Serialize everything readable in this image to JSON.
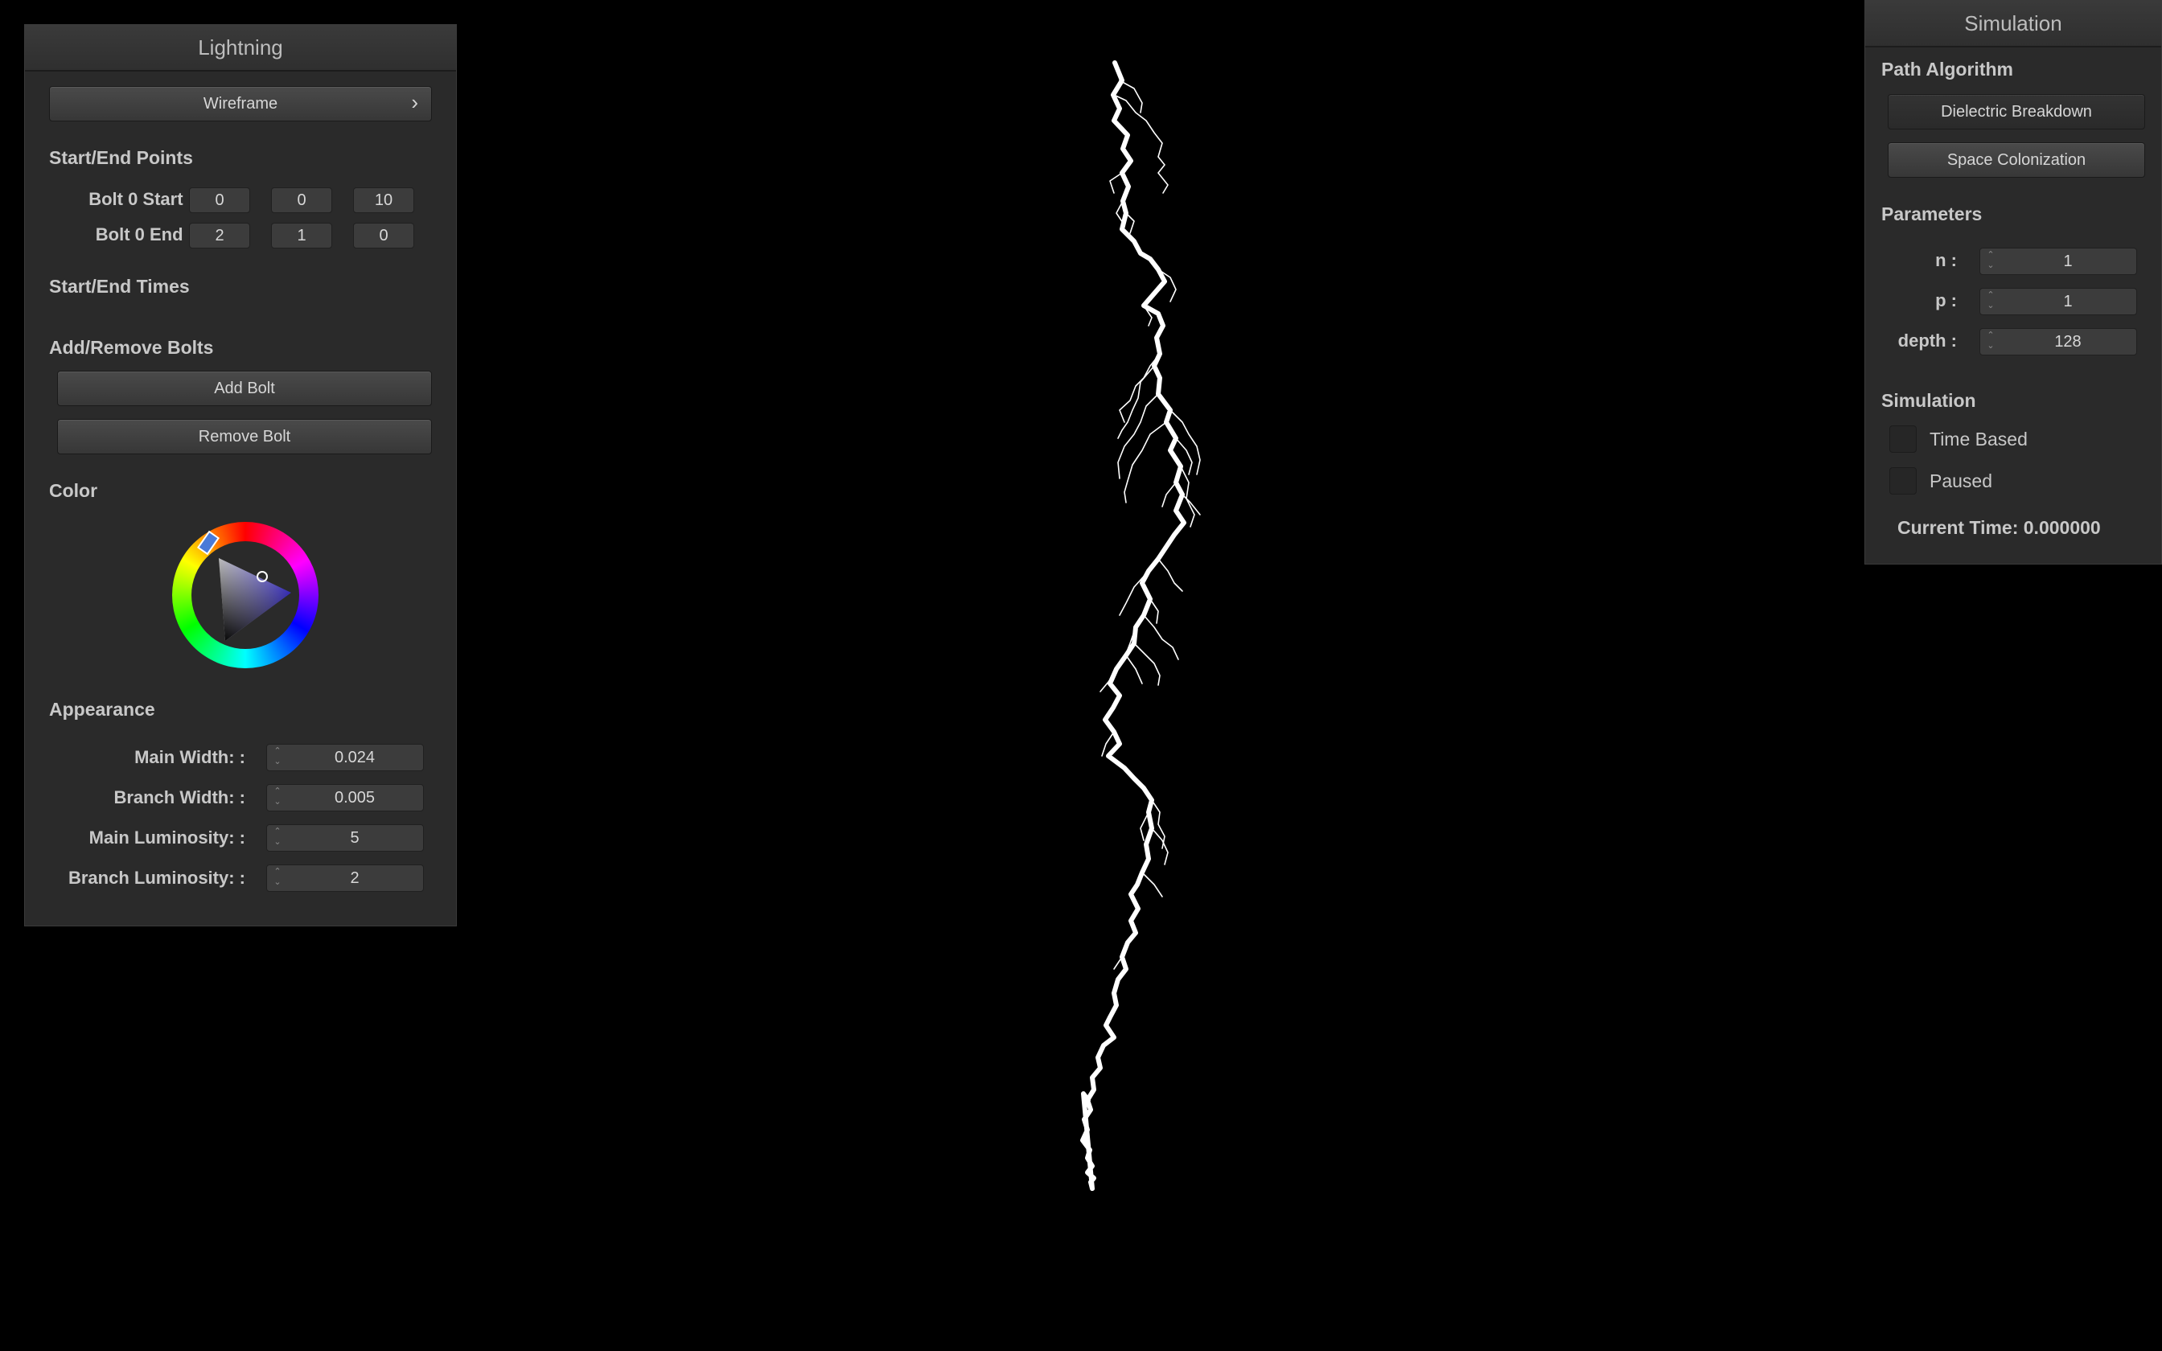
{
  "lightning_panel": {
    "title": "Lightning",
    "mode_button": "Wireframe",
    "mode_chevron": "›",
    "start_end_points": {
      "heading": "Start/End Points",
      "start_label": "Bolt 0 Start :",
      "start_values": [
        "0",
        "0",
        "10"
      ],
      "end_label": "Bolt 0 End :",
      "end_values": [
        "2",
        "1",
        "0"
      ]
    },
    "start_end_times": {
      "heading": "Start/End Times"
    },
    "add_remove": {
      "heading": "Add/Remove Bolts",
      "add_label": "Add Bolt",
      "remove_label": "Remove Bolt"
    },
    "color": {
      "heading": "Color",
      "selected_color": "#3a2fd0"
    },
    "appearance": {
      "heading": "Appearance",
      "main_width_label": "Main Width: :",
      "main_width": "0.024",
      "branch_width_label": "Branch Width: :",
      "branch_width": "0.005",
      "main_luminosity_label": "Main Luminosity: :",
      "main_luminosity": "5",
      "branch_luminosity_label": "Branch Luminosity: :",
      "branch_luminosity": "2"
    }
  },
  "simulation_panel": {
    "title": "Simulation",
    "path_algorithm": {
      "heading": "Path Algorithm",
      "option1": "Dielectric Breakdown",
      "option2": "Space Colonization"
    },
    "parameters": {
      "heading": "Parameters",
      "n_label": "n :",
      "n_value": "1",
      "p_label": "p :",
      "p_value": "1",
      "depth_label": "depth :",
      "depth_value": "128"
    },
    "simulation": {
      "heading": "Simulation",
      "time_based_label": "Time Based",
      "time_based_checked": false,
      "paused_label": "Paused",
      "paused_checked": false,
      "current_time_text": "Current Time: 0.000000"
    }
  },
  "viewport": {
    "bolt_color": "#ffffff",
    "background": "#000000"
  }
}
